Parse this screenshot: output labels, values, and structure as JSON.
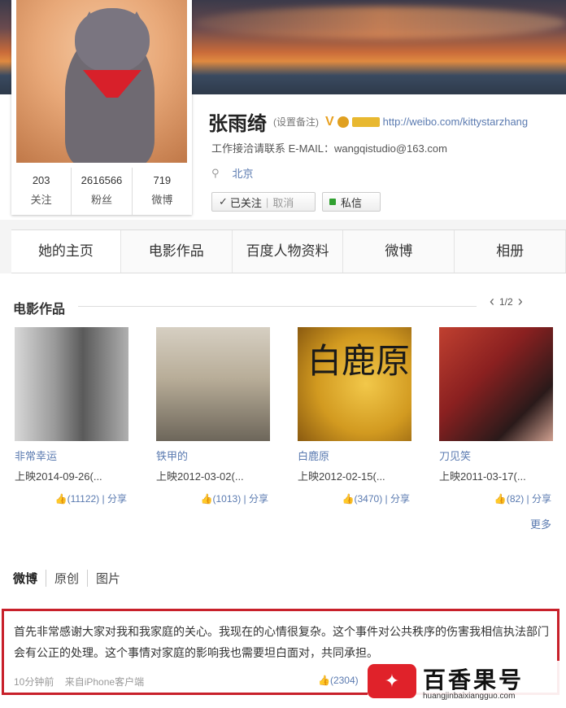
{
  "profile": {
    "name": "张雨绮",
    "remark": "(设置备注)",
    "verified_badge": "V",
    "url": "http://weibo.com/kittystarzhang",
    "contact": "工作接洽请联系 E-MAIL：wangqistudio@163.com",
    "location": "北京",
    "stats": [
      {
        "num": "203",
        "label": "关注"
      },
      {
        "num": "2616566",
        "label": "粉丝"
      },
      {
        "num": "719",
        "label": "微博"
      }
    ],
    "follow_label": "已关注",
    "cancel_label": "取消",
    "message_label": "私信"
  },
  "icons": {
    "pin": "location-pin-icon",
    "check": "check-icon",
    "like": "thumbs-up-icon"
  },
  "tabs": [
    "她的主页",
    "电影作品",
    "百度人物资料",
    "微博",
    "相册"
  ],
  "films_section": {
    "title": "电影作品",
    "pager": "1/2",
    "more": "更多",
    "movies": [
      {
        "title": "非常幸运",
        "date": "上映2014-09-26(...",
        "likes": "(11122)",
        "share": "分享"
      },
      {
        "title": "铁甲的",
        "date": "上映2012-03-02(...",
        "likes": "(1013)",
        "share": "分享"
      },
      {
        "title": "白鹿原",
        "date": "上映2012-02-15(...",
        "likes": "(3470)",
        "share": "分享"
      },
      {
        "title": "刀见笑",
        "date": "上映2011-03-17(...",
        "likes": "(82)",
        "share": "分享"
      }
    ],
    "poster_text": "白鹿原"
  },
  "feed": {
    "tabs": [
      "微博",
      "原创",
      "图片"
    ],
    "post": {
      "text": "首先非常感谢大家对我和我家庭的关心。我现在的心情很复杂。这个事件对公共秩序的伤害我相信执法部门会有公正的处理。这个事情对家庭的影响我也需要坦白面对，共同承担。",
      "time": "10分钟前",
      "source": "来自iPhone客户端",
      "likes": "(2304)"
    }
  },
  "watermark": {
    "text": "百香果号",
    "url": "huangjinbaixiangguo.com"
  },
  "colors": {
    "link": "#5a7ab0",
    "highlight_border": "#c8202a",
    "verified": "#e8a020"
  }
}
